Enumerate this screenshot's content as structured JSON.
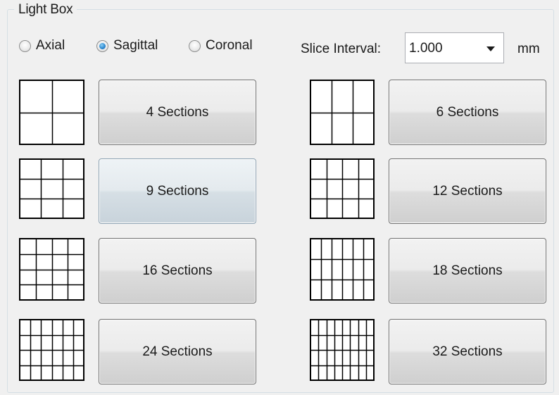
{
  "group": {
    "title": "Light Box"
  },
  "orientation": {
    "options": [
      {
        "label": "Axial",
        "checked": false
      },
      {
        "label": "Sagittal",
        "checked": true
      },
      {
        "label": "Coronal",
        "checked": false
      }
    ]
  },
  "slice_interval": {
    "label": "Slice Interval:",
    "value": "1.000",
    "unit": "mm"
  },
  "layouts": [
    {
      "label": "4 Sections",
      "cols": 2,
      "rows": 2
    },
    {
      "label": "6 Sections",
      "cols": 3,
      "rows": 2
    },
    {
      "label": "9 Sections",
      "cols": 3,
      "rows": 3
    },
    {
      "label": "12 Sections",
      "cols": 4,
      "rows": 3
    },
    {
      "label": "16 Sections",
      "cols": 4,
      "rows": 4
    },
    {
      "label": "18 Sections",
      "cols": 6,
      "rows": 3
    },
    {
      "label": "24 Sections",
      "cols": 6,
      "rows": 4
    },
    {
      "label": "32 Sections",
      "cols": 8,
      "rows": 4
    }
  ],
  "colors": {
    "panel_bg": "#f0f0f0",
    "frame": "#d5dfe5",
    "button_border": "#707070",
    "radio_accent": "#2e8ad1"
  }
}
